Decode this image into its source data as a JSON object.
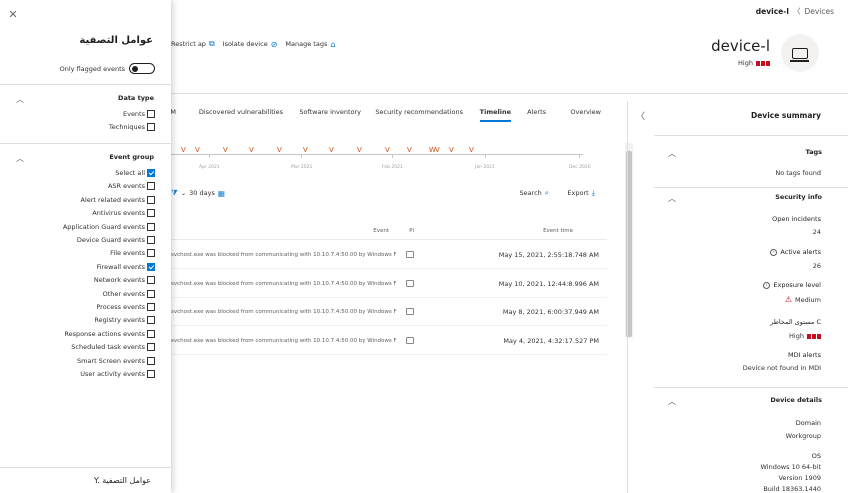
{
  "breadcrumb": {
    "items": [
      "Devices",
      "device-l"
    ]
  },
  "device": {
    "name": "device-l",
    "risk": "High"
  },
  "actions": [
    {
      "label": "Manage tags",
      "icon": "tag-icon"
    },
    {
      "label": "Isolate device",
      "icon": "isolate-icon"
    },
    {
      "label": "Restrict ap",
      "icon": "restrict-icon"
    }
  ],
  "tabs": [
    "Overview",
    "Alerts",
    "Timeline",
    "Security recommendations",
    "Software inventory",
    "Discovered vulnerabilities",
    "M"
  ],
  "timeline": {
    "dates": [
      "Dec 2020",
      "Jan 2021",
      "Feb 2021",
      "Mar 2021",
      "Apr 2021"
    ]
  },
  "toolbar": {
    "export": "Export",
    "search": "Search",
    "range": "30 days"
  },
  "table": {
    "headers": {
      "time": "Event time",
      "event": "Event",
      "flag": "Pi"
    },
    "rows": [
      {
        "time": "May 15, 2021, 2:55:18.748 AM",
        "event": "svchost.exe was blocked from communicating with 10.10.7.4:50.00 by Windows F"
      },
      {
        "time": "May 10, 2021, 12:44:8.996 AM",
        "event": "svchost.exe was blocked from communicating with 10.10.7.4:50.00 by Windows F"
      },
      {
        "time": "May 8, 2021, 6:00:37.949 AM",
        "event": "svchost.exe was blocked from communicating with 10.10.7.4:50.00 by Windows F"
      },
      {
        "time": "May 4, 2021, 4:32:17.527 PM",
        "event": "svchost.exe was blocked from communicating with 10.10.7.4:50.00 by Windows F"
      }
    ]
  },
  "filter_panel": {
    "title": "عوامل التصفية",
    "only_flagged": "Only flagged events",
    "data_type": {
      "title": "Data type",
      "items": [
        {
          "label": "Events",
          "checked": false
        },
        {
          "label": "Techniques",
          "checked": false
        }
      ]
    },
    "event_group": {
      "title": "Event group",
      "items": [
        {
          "label": "Select all",
          "checked": true
        },
        {
          "label": "ASR events",
          "checked": false
        },
        {
          "label": "Alert related events",
          "checked": false
        },
        {
          "label": "Antivirus events",
          "checked": false
        },
        {
          "label": "Application Guard events",
          "checked": false
        },
        {
          "label": "Device Guard events",
          "checked": false
        },
        {
          "label": "File events",
          "checked": false
        },
        {
          "label": "Firewall events",
          "checked": true
        },
        {
          "label": "Network events",
          "checked": false
        },
        {
          "label": "Other events",
          "checked": false
        },
        {
          "label": "Process events",
          "checked": false
        },
        {
          "label": "Registry events",
          "checked": false
        },
        {
          "label": "Response actions events",
          "checked": false
        },
        {
          "label": "Scheduled task events",
          "checked": false
        },
        {
          "label": "Smart Screen events",
          "checked": false
        },
        {
          "label": "User activity events",
          "checked": false
        }
      ]
    },
    "footer": "Y. عوامل التصفية"
  },
  "summary": {
    "title": "Device summary",
    "tags": {
      "title": "Tags",
      "value": "No tags found"
    },
    "security_info": {
      "title": "Security info",
      "open_incidents_label": "Open incidents",
      "open_incidents": "24",
      "active_alerts_label": "Active alerts",
      "active_alerts": "26",
      "exposure_label": "Exposure level",
      "exposure": "Medium",
      "risk_label": "مستوى المخاطر C",
      "risk": "High",
      "mdi_label": "MDI alerts",
      "mdi": "Device not found in MDI"
    },
    "device_details": {
      "title": "Device details",
      "domain_label": "Domain",
      "domain": "Workgroup",
      "os_label": "OS",
      "os": "Windows 10 64-bit",
      "version": "Version 1909",
      "build": "Build 18363.1440"
    }
  }
}
